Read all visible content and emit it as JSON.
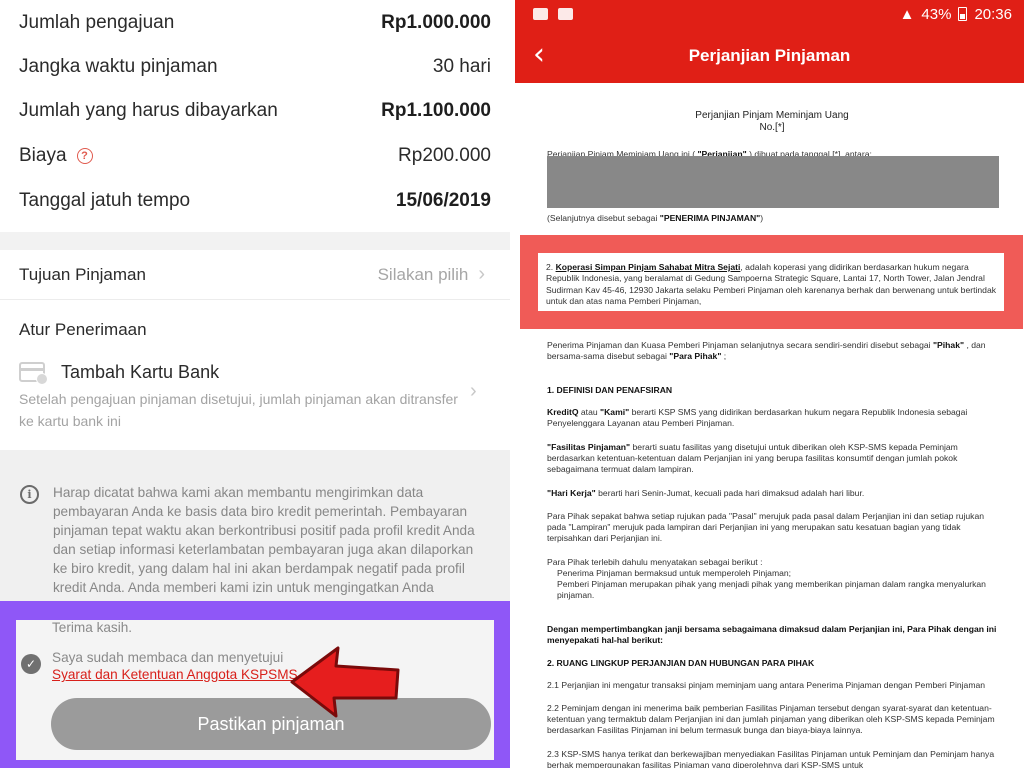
{
  "left": {
    "summary": [
      {
        "label": "Jumlah pengajuan",
        "value": "Rp1.000.000"
      },
      {
        "label": "Jangka waktu pinjaman",
        "value": "30 hari"
      },
      {
        "label": "Jumlah yang harus dibayarkan",
        "value": "Rp1.100.000"
      },
      {
        "label": "Biaya",
        "value": "Rp200.000"
      },
      {
        "label": "Tanggal jatuh tempo",
        "value": "15/06/2019"
      }
    ],
    "help_glyph": "?",
    "purpose_label": "Tujuan Pinjaman",
    "purpose_placeholder": "Silakan pilih",
    "chevron": "›",
    "receive_title": "Atur Penerimaan",
    "add_card_label": "Tambah Kartu Bank",
    "add_card_desc": "Setelah pengajuan pinjaman disetujui, jumlah pinjaman akan ditransfer ke kartu bank ini",
    "info_glyph": "i",
    "notice": "Harap dicatat bahwa kami akan membantu mengirimkan data pembayaran Anda ke basis data biro kredit pemerintah. Pembayaran pinjaman tepat waktu akan berkontribusi positif pada profil kredit Anda dan setiap informasi keterlambatan pembayaran juga akan dilaporkan ke biro kredit, yang dalam hal ini akan berdampak negatif pada profil kredit Anda. Anda memberi kami izin untuk mengingatkan Anda sebelum tanggal jatuh tempo pembayaran",
    "thanks": "Terima kasih.",
    "check_glyph": "✓",
    "agree_text": "Saya sudah membaca dan menyetujui",
    "agree_link": "Syarat dan Ketentuan Anggota KSPSMS",
    "confirm_button": "Pastikan pinjaman"
  },
  "right": {
    "status": {
      "battery": "43%",
      "time": "20:36"
    },
    "back_glyph": "‹",
    "title": "Perjanjian Pinjaman",
    "doc_title_line1": "Perjanjian Pinjam Meminjam Uang",
    "doc_title_line2": "No.[*]",
    "intro_a": "Perjanjian Pinjam Meminjam Uang ini ( ",
    "intro_b": "\"Perjanjian\"",
    "intro_c": " ) dibuat pada tanggal [*], antara:",
    "borrower_a": "(Selanjutnya disebut sebagai ",
    "borrower_b": "\"PENERIMA PINJAMAN\"",
    "borrower_c": ")",
    "party2_num": "2.",
    "party2_name": "Koperasi Simpan Pinjam Sahabat Mitra Sejati",
    "party2_rest": ", adalah koperasi yang didirikan berdasarkan hukum negara Republik Indonesia, yang beralamat di Gedung Sampoerna Strategic Square, Lantai 17, North Tower, Jalan Jendral Sudirman Kav 45-46, 12930 Jakarta selaku Pemberi Pinjaman oleh karenanya berhak dan berwenang untuk bertindak untuk dan atas nama Pemberi Pinjaman,",
    "parties_a": "Penerima Pinjaman dan Kuasa Pemberi Pinjaman selanjutnya secara sendiri-sendiri disebut sebagai ",
    "parties_b": "\"Pihak\"",
    "parties_c": " , dan bersama-sama disebut sebagai ",
    "parties_d": "\"Para Pihak\"",
    "parties_e": " ;",
    "sec1": "1. DEFINISI DAN PENAFSIRAN",
    "kreditq_a": "KreditQ",
    "kreditq_b": " atau ",
    "kreditq_c": "\"Kami\"",
    "kreditq_d": " berarti KSP SMS yang didirikan berdasarkan hukum negara Republik Indonesia sebagai Penyelenggara Layanan atau Pemberi Pinjaman.",
    "fasilitas_a": "\"Fasilitas Pinjaman\"",
    "fasilitas_b": " berarti suatu fasilitas yang disetujui untuk diberikan oleh KSP-SMS kepada Peminjam berdasarkan ketentuan-ketentuan dalam Perjanjian ini yang berupa fasilitas konsumtif dengan jumlah pokok sebagaimana termuat dalam lampiran.",
    "harikerja_a": "\"Hari Kerja\"",
    "harikerja_b": " berarti hari Senin-Jumat, kecuali pada hari dimaksud adalah hari libur.",
    "pasal": "Para Pihak sepakat bahwa setiap rujukan pada \"Pasal\" merujuk pada pasal dalam Perjanjian ini dan setiap rujukan pada \"Lampiran\" merujuk pada lampiran dari Perjanjian ini yang merupakan satu kesatuan bagian yang tidak terpisahkan dari Perjanjian ini.",
    "terlebih": "Para Pihak terlebih dahulu menyatakan sebagai berikut :",
    "terlebih_1": "Penerima Pinjaman bermaksud untuk memperoleh Pinjaman;",
    "terlebih_2": "Pemberi Pinjaman merupakan pihak yang menjadi pihak yang memberikan pinjaman dalam rangka menyalurkan pinjaman.",
    "mempertimbangkan": "Dengan mempertimbangkan janji bersama sebagaimana dimaksud dalam Perjanjian ini, Para Pihak dengan ini menyepakati hal-hal berikut:",
    "sec2": "2. RUANG LINGKUP PERJANJIAN DAN HUBUNGAN PARA PIHAK",
    "p21": "2.1  Perjanjian ini mengatur transaksi pinjam meminjam uang antara Penerima Pinjaman dengan Pemberi Pinjaman",
    "p22": "2.2    Peminjam dengan ini menerima baik pemberian Fasilitas Pinjaman tersebut dengan syarat-syarat dan ketentuan-ketentuan yang termaktub dalam Perjanjian ini dan jumlah pinjaman yang diberikan oleh KSP-SMS kepada Peminjam berdasarkan Fasilitas Pinjaman ini belum termasuk bunga dan biaya-biaya lainnya.",
    "p23": "2.3    KSP-SMS hanya terikat dan berkewajiban menyediakan Fasilitas Pinjaman untuk Peminjam dan Peminjam hanya berhak mempergunakan fasilitas Pinjaman yang diperolehnya dari KSP-SMS untuk"
  },
  "colors": {
    "brand_red": "#e01f16",
    "highlight_purple": "#8f57f7",
    "highlight_red": "#f05b57",
    "link_red": "#d8201a"
  }
}
